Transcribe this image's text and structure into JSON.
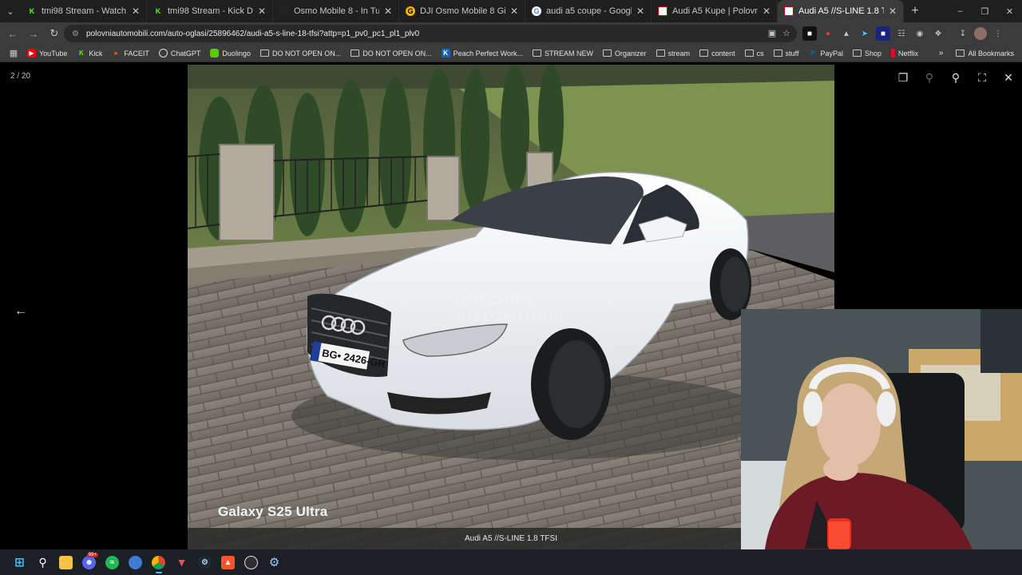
{
  "tabs": [
    {
      "title": "tmi98 Stream - Watch Live on K",
      "favicon": "kick-icon",
      "color": "#53fc18"
    },
    {
      "title": "tmi98 Stream - Kick Dashboard",
      "favicon": "kick-icon",
      "color": "#53fc18"
    },
    {
      "title": "Osmo Mobile 8 - In Tune With",
      "favicon": "dji-icon",
      "color": "#333333"
    },
    {
      "title": "DJI Osmo Mobile 8 Gimbal | Gi",
      "favicon": "gigatron-icon",
      "color": "#f5b400"
    },
    {
      "title": "audi a5 coupe - Google Search",
      "favicon": "google-icon",
      "color": "#ffffff"
    },
    {
      "title": "Audi A5 Kupe | Polovni automo",
      "favicon": "polovni-icon",
      "color": "#ffffff"
    },
    {
      "title": "Audi A5 //S-LINE 1.8 TFSI | Polo",
      "favicon": "polovni-icon",
      "color": "#ffffff",
      "active": true
    }
  ],
  "address": {
    "url": "polovniautomobili.com/auto-oglasi/25896462/audi-a5-s-line-18-tfsi?attp=p1_pv0_pc1_pl1_plv0"
  },
  "bookmarks": [
    {
      "label": "YouTube",
      "icon": "youtube-icon"
    },
    {
      "label": "Kick",
      "icon": "kick-icon"
    },
    {
      "label": "FACEIT",
      "icon": "faceit-icon"
    },
    {
      "label": "ChatGPT",
      "icon": "chatgpt-icon"
    },
    {
      "label": "Duolingo",
      "icon": "duolingo-icon"
    },
    {
      "label": "DO NOT OPEN ON...",
      "icon": "folder-icon"
    },
    {
      "label": "DO NOT OPEN ON...",
      "icon": "folder-icon"
    },
    {
      "label": "Peach Perfect Work...",
      "icon": "peach-icon"
    },
    {
      "label": "STREAM NEW",
      "icon": "folder-icon"
    },
    {
      "label": "Organizer",
      "icon": "folder-icon"
    },
    {
      "label": "stream",
      "icon": "folder-icon"
    },
    {
      "label": "content",
      "icon": "folder-icon"
    },
    {
      "label": "cs",
      "icon": "folder-icon"
    },
    {
      "label": "stuff",
      "icon": "folder-icon"
    },
    {
      "label": "PayPal",
      "icon": "paypal-icon"
    },
    {
      "label": "Shop",
      "icon": "folder-icon"
    },
    {
      "label": "Netflix",
      "icon": "netflix-icon"
    }
  ],
  "all_bookmarks": "All Bookmarks",
  "viewer": {
    "counter": "2 / 20",
    "phone_watermark": "Galaxy S25 Ultra",
    "site_watermark_line1": "POLOVNI",
    "site_watermark_line2": "AUTOMOBILI",
    "caption": "Audi A5 //S-LINE 1.8 TFSI",
    "plate": "BG• 2426-GR"
  },
  "taskbar": {
    "discord_badge": "99+"
  }
}
